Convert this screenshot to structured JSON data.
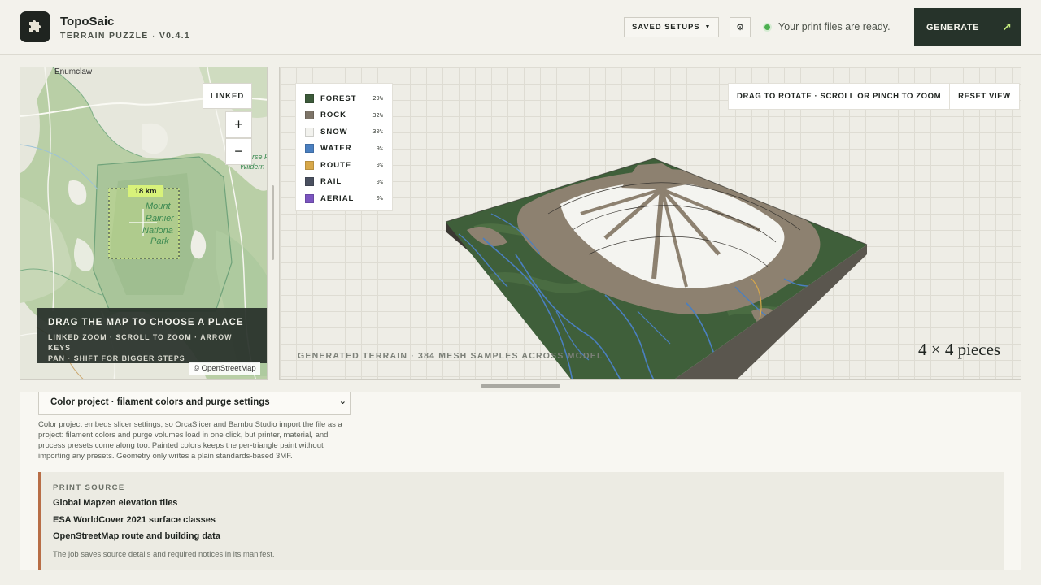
{
  "header": {
    "app_name": "TopoSaic",
    "app_subtitle": "TERRAIN PUZZLE",
    "version": "V0.4.1",
    "saved_setups_label": "SAVED SETUPS",
    "gear_label": "⚙",
    "status_text": "Your print files are ready.",
    "generate_label": "GENERATE",
    "generate_arrow": "↗",
    "colors": {
      "generate_bg": "#26332a",
      "status_dot": "#4caf50",
      "accent": "#c8f080"
    }
  },
  "map": {
    "place_label": "Enumclaw",
    "park_label_lines": [
      "Mount",
      "Rainier",
      "Nationa",
      "Park"
    ],
    "wilderness_label_lines": [
      "rse P",
      "Wildern"
    ],
    "linked_label": "LINKED",
    "zoom_in_label": "+",
    "zoom_out_label": "−",
    "scale_label": "18 km",
    "overlay_title": "DRAG THE MAP TO CHOOSE A PLACE",
    "overlay_hint_1": "LINKED ZOOM · SCROLL TO ZOOM · ARROW KEYS",
    "overlay_hint_2": "PAN · SHIFT FOR BIGGER STEPS",
    "attribution": "© OpenStreetMap"
  },
  "preview": {
    "legend": [
      {
        "name": "FOREST",
        "percent": "29%",
        "color": "#3c5a3a"
      },
      {
        "name": "ROCK",
        "percent": "32%",
        "color": "#7d7468"
      },
      {
        "name": "SNOW",
        "percent": "30%",
        "color": "#f2f2ee"
      },
      {
        "name": "WATER",
        "percent": "9%",
        "color": "#4a7fc0"
      },
      {
        "name": "ROUTE",
        "percent": "0%",
        "color": "#d8a84a"
      },
      {
        "name": "RAIL",
        "percent": "0%",
        "color": "#4a5060"
      },
      {
        "name": "AERIAL",
        "percent": "0%",
        "color": "#7b55c0"
      }
    ],
    "view_hint": "DRAG TO ROTATE · SCROLL OR PINCH TO ZOOM",
    "reset_label": "RESET VIEW",
    "caption": "GENERATED TERRAIN · 384 MESH SAMPLES ACROSS MODEL",
    "pieces": "4 × 4 pieces"
  },
  "settings": {
    "project_select": "Color project · filament colors and purge settings",
    "chevron": "⌄",
    "description": "Color project embeds slicer settings, so OrcaSlicer and Bambu Studio import the file as a project: filament colors and purge volumes load in one click, but printer, material, and process presets come along too. Painted colors keeps the per-triangle paint without importing any presets. Geometry only writes a plain standards-based 3MF.",
    "source_label": "PRINT SOURCE",
    "sources": [
      "Global Mapzen elevation tiles",
      "ESA WorldCover 2021 surface classes",
      "OpenStreetMap route and building data"
    ],
    "source_note": "The job saves source details and required notices in its manifest."
  }
}
